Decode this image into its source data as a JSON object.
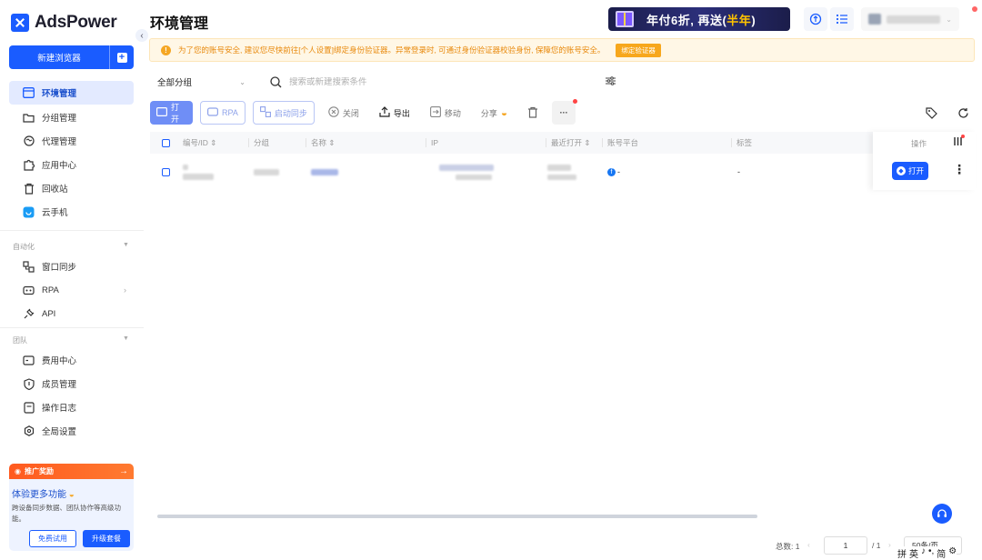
{
  "brand": {
    "name": "AdsPower"
  },
  "sidebar": {
    "new_browser": "新建浏览器",
    "items": [
      {
        "label": "环境管理",
        "icon": "browser-window-icon",
        "active": true
      },
      {
        "label": "分组管理",
        "icon": "folder-icon"
      },
      {
        "label": "代理管理",
        "icon": "proxy-icon"
      },
      {
        "label": "应用中心",
        "icon": "puzzle-icon"
      },
      {
        "label": "回收站",
        "icon": "trash-icon"
      },
      {
        "label": "云手机",
        "icon": "cloud-phone-icon"
      }
    ],
    "section_automation": "自动化",
    "automation_items": [
      {
        "label": "窗口同步",
        "icon": "sync-window-icon"
      },
      {
        "label": "RPA",
        "icon": "rpa-icon"
      },
      {
        "label": "API",
        "icon": "api-plug-icon"
      }
    ],
    "section_team": "团队",
    "team_items": [
      {
        "label": "费用中心",
        "icon": "billing-icon"
      },
      {
        "label": "成员管理",
        "icon": "shield-user-icon"
      },
      {
        "label": "操作日志",
        "icon": "log-icon"
      },
      {
        "label": "全局设置",
        "icon": "settings-icon"
      }
    ],
    "promo": {
      "tag": "推广奖励",
      "title": "体验更多功能",
      "desc": "跨设备同步数据、团队协作等高级功能。",
      "trial": "免费试用",
      "upgrade": "升级套餐"
    }
  },
  "header": {
    "title": "环境管理",
    "banner_prefix": "年付6折, 再送(",
    "banner_highlight": "半年",
    "banner_suffix": ")"
  },
  "notice": {
    "text": "为了您的账号安全, 建议您尽快前往[个人设置]绑定身份验证器。异常登录时, 可通过身份验证器校验身份, 保障您的账号安全。",
    "button": "绑定验证器"
  },
  "filters": {
    "group": "全部分组",
    "search_placeholder": "搜索或新建搜索条件"
  },
  "toolbar": {
    "open": "打开",
    "rpa": "RPA",
    "start_sync": "启动同步",
    "close": "关闭",
    "export": "导出",
    "move": "移动",
    "share": "分享",
    "more": "···"
  },
  "table": {
    "headers": [
      "编号/ID",
      "分组",
      "名称",
      "IP",
      "最近打开",
      "账号平台",
      "标签",
      "操作"
    ],
    "rows": [
      {
        "platform": "-",
        "tag": "-",
        "open": "打开"
      }
    ]
  },
  "pagination": {
    "total": "总数: 1",
    "page": "1",
    "of": "/ 1",
    "page_size": "50条/页"
  },
  "ime": [
    "拼",
    "英",
    "♪",
    "•,",
    "简",
    "⚙"
  ],
  "colors": {
    "accent": "#1a5cff",
    "warning": "#f5a623",
    "promo": "#ff5a1f"
  }
}
